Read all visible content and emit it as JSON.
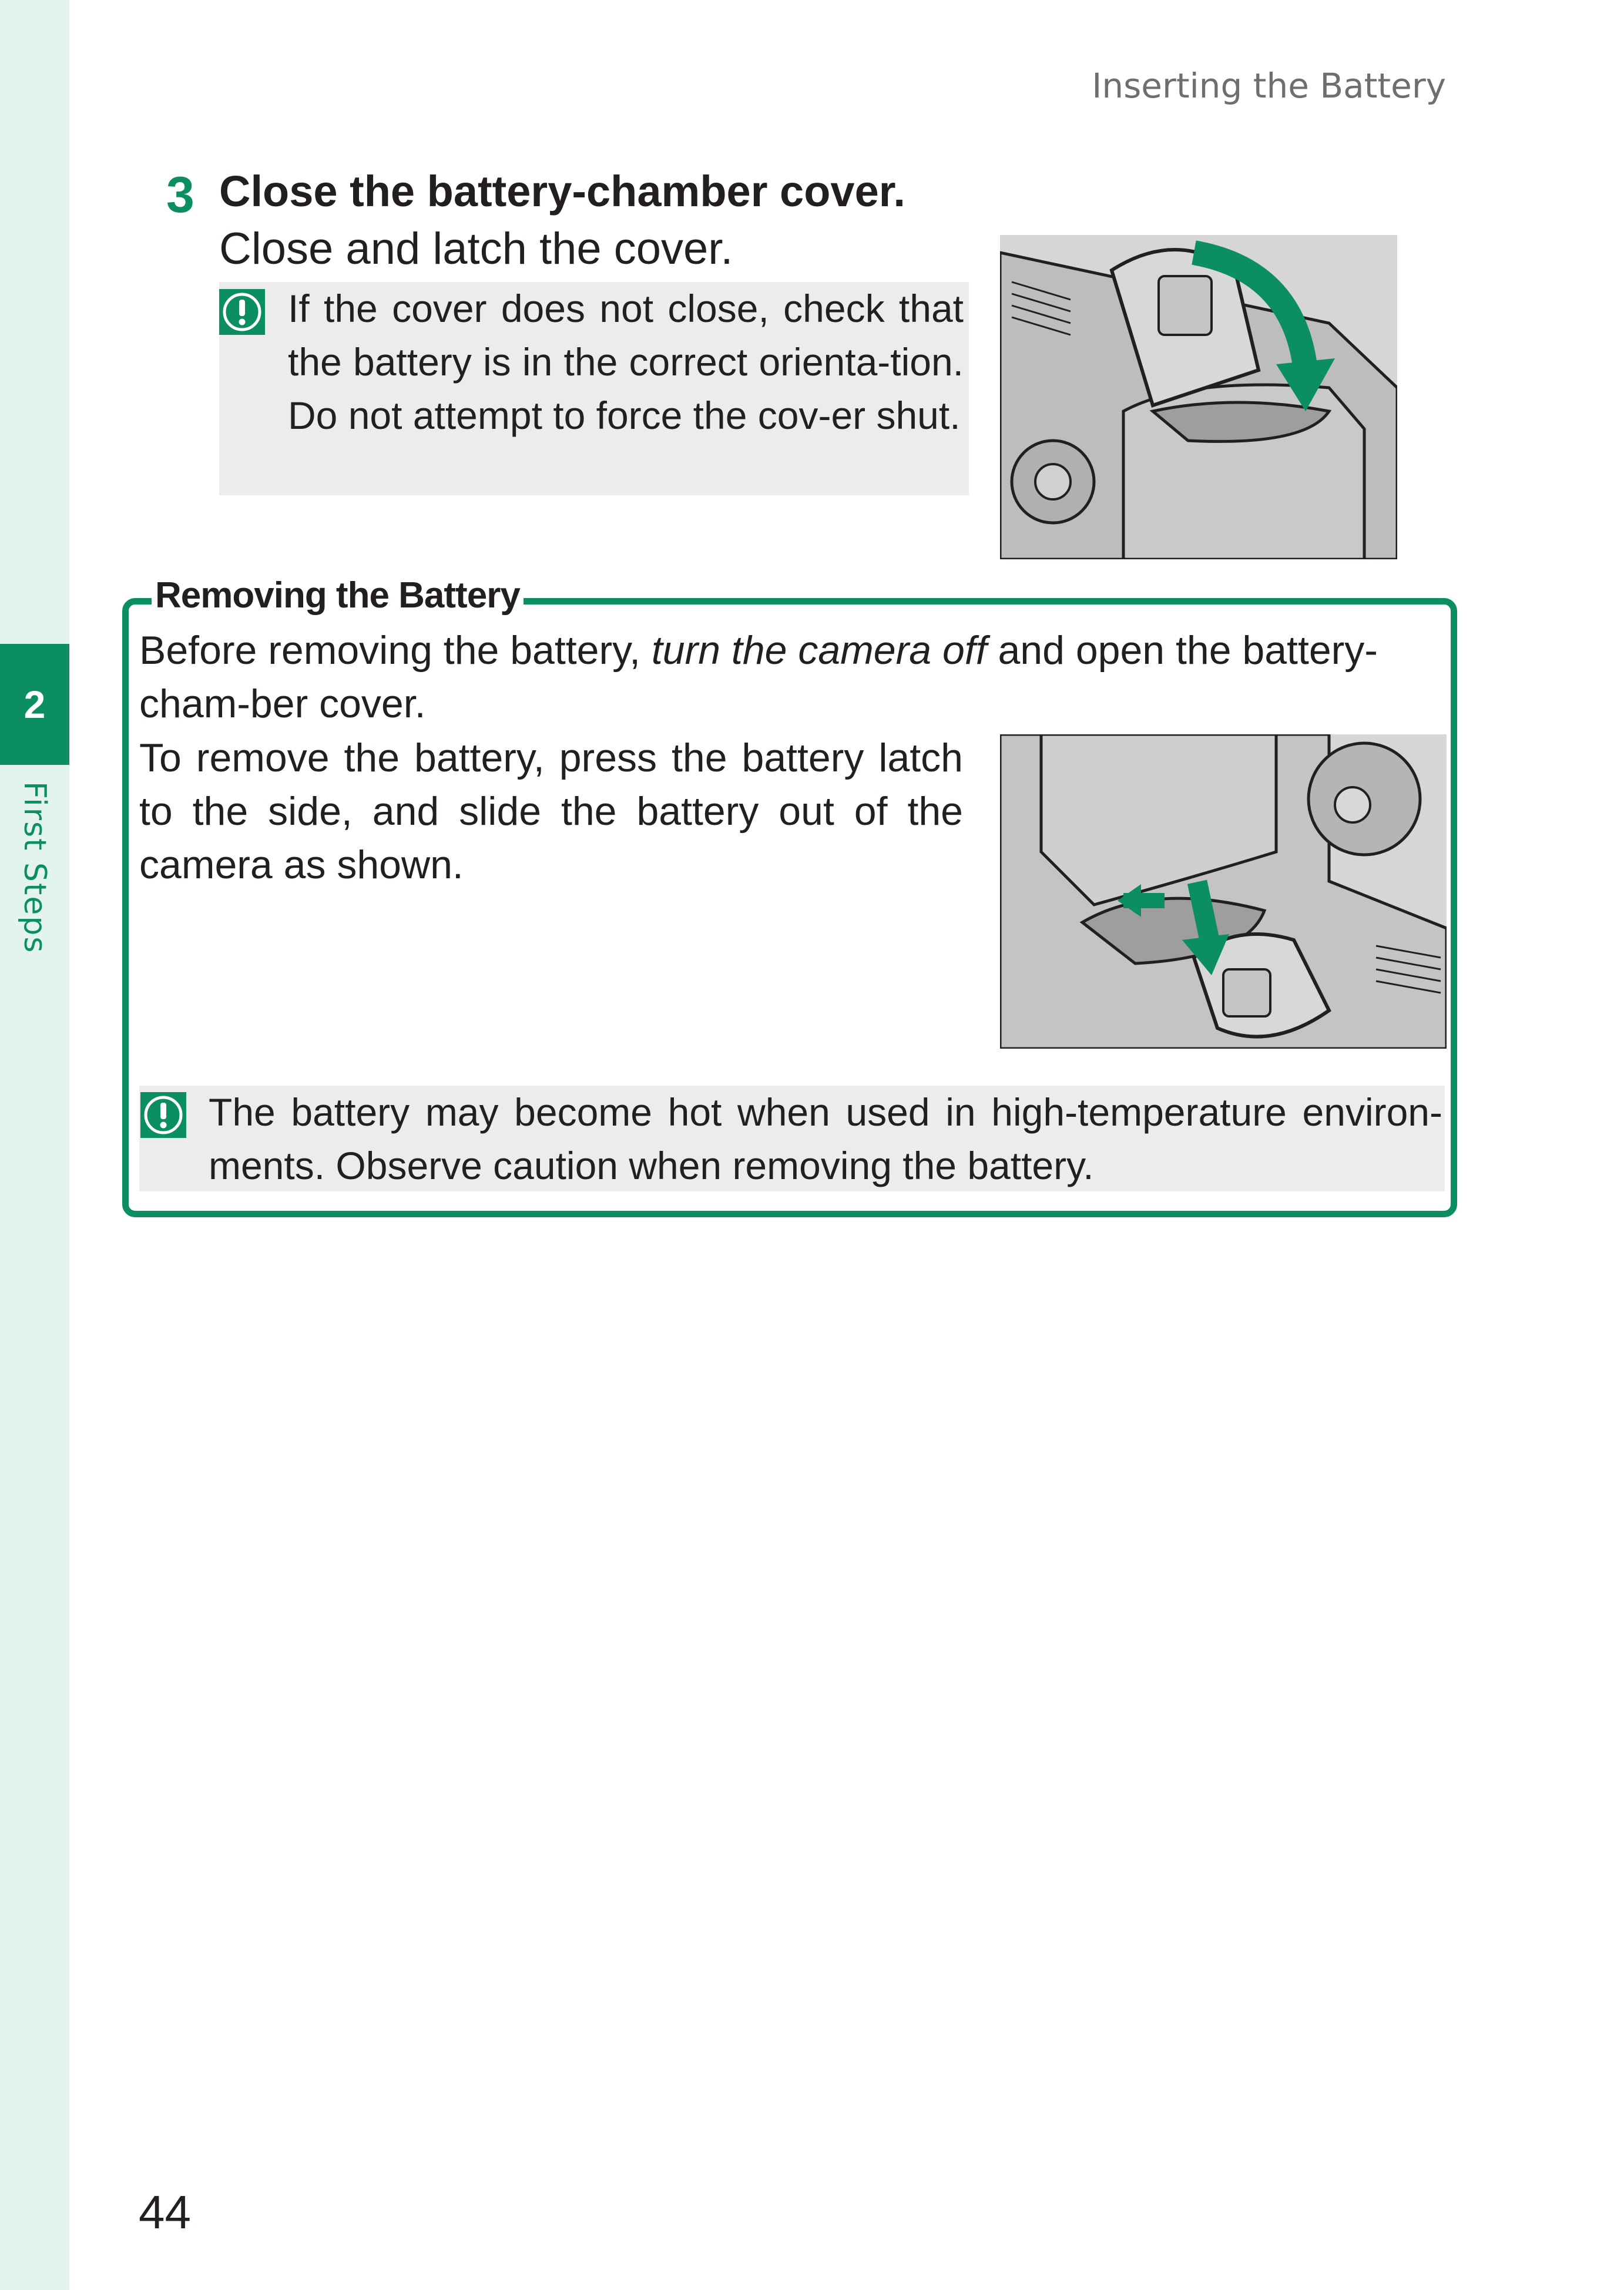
{
  "running_head": "Inserting the Battery",
  "chapter": {
    "number": "2",
    "label": "First Steps"
  },
  "step": {
    "number": "3",
    "title": "Close the battery-chamber cover.",
    "subtitle": "Close and latch the cover.",
    "note": "If the cover does not close, check that the battery is in the correct orienta-tion. Do not attempt to force the cov-er shut."
  },
  "removing": {
    "title": "Removing the Battery",
    "para1_a": "Before removing the battery, ",
    "para1_em": "turn the camera off",
    "para1_b": " and open the battery-cham-ber cover.",
    "para2": "To remove the battery, press the battery latch to the side, and slide the battery out of the camera as shown.",
    "note": "The battery may become hot when used in high-temperature environ-ments. Observe caution when removing the battery."
  },
  "page_number": "44",
  "colors": {
    "accent": "#0c8f60",
    "strip": "#e3f3ee",
    "note_bg": "#ececec"
  },
  "icons": [
    "caution-icon",
    "camera-cover-closing-illustration",
    "battery-removal-illustration"
  ]
}
